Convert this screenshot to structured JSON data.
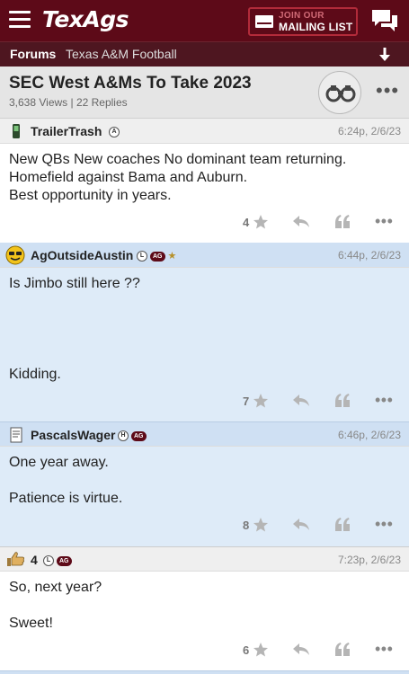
{
  "app": {
    "logo": "TexAgs",
    "mailing_line1": "JOIN OUR",
    "mailing_line2": "MAILING LIST"
  },
  "breadcrumb": {
    "forums": "Forums",
    "section": "Texas A&M Football"
  },
  "thread": {
    "title": "SEC West A&Ms To Take 2023",
    "stats": "3,638 Views | 22 Replies"
  },
  "posts": [
    {
      "username": "TrailerTrash",
      "badges": [
        "A"
      ],
      "time": "6:24p, 2/6/23",
      "lines": [
        "New QBs New coaches No dominant team returning.",
        "Homefield against Bama and Auburn.",
        "Best opportunity in years."
      ],
      "likes": "4"
    },
    {
      "username": "AgOutsideAustin",
      "badges": [
        "L",
        "AG",
        "star"
      ],
      "time": "6:44p, 2/6/23",
      "lines": [
        "Is Jimbo still here ??",
        "Kidding."
      ],
      "likes": "7"
    },
    {
      "username": "PascalsWager",
      "badges": [
        "H",
        "AG"
      ],
      "time": "6:46p, 2/6/23",
      "lines": [
        "One year away.",
        "Patience is virtue."
      ],
      "likes": "8"
    },
    {
      "username": "4",
      "badges": [
        "L",
        "AG"
      ],
      "time": "7:23p, 2/6/23",
      "lines": [
        "So, next year?",
        "Sweet!"
      ],
      "likes": "6"
    }
  ],
  "colors": {
    "brand_maroon": "#5d0a18",
    "post_blue": "#deebf8",
    "post_white": "#ffffff"
  },
  "icons": [
    "hamburger-icon",
    "mail-icon",
    "chat-icon",
    "arrow-down-icon",
    "binoculars-icon",
    "star-icon",
    "reply-icon",
    "quote-icon",
    "more-icon"
  ]
}
